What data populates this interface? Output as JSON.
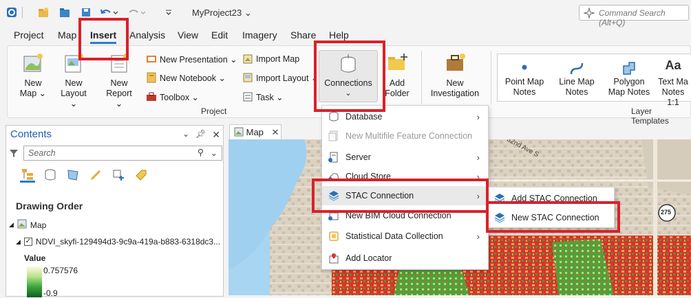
{
  "titlebar": {
    "project_title": "MyProject23 ⌄",
    "command_search": "Command Search (Alt+Q)"
  },
  "menu": {
    "tabs": [
      {
        "label": "Project"
      },
      {
        "label": "Map"
      },
      {
        "label": "Insert"
      },
      {
        "label": "Analysis"
      },
      {
        "label": "View"
      },
      {
        "label": "Edit"
      },
      {
        "label": "Imagery"
      },
      {
        "label": "Share"
      },
      {
        "label": "Help"
      }
    ]
  },
  "ribbon": {
    "new_map": "New Map ⌄",
    "new_layout": "New Layout ⌄",
    "new_report": "New Report ⌄",
    "new_presentation": "New Presentation ⌄",
    "new_notebook": "New Notebook ⌄",
    "toolbox": "Toolbox ⌄",
    "import_map": "Import Map",
    "import_layout": "Import Layout ⌄",
    "task": "Task ⌄",
    "connections": "Connections",
    "add_folder": "Add Folder",
    "new_investigation": "New Investigation",
    "group_project": "Project",
    "point_map_notes": "Point Map Notes",
    "line_map_notes": "Line Map Notes",
    "polygon_map_notes": "Polygon Map Notes",
    "text_map_notes": "Text Ma Notes 1:1",
    "group_layer_templates": "Layer Templates"
  },
  "contents": {
    "title": "Contents",
    "search_placeholder": "Search",
    "drawing_order": "Drawing Order",
    "map_item": "Map",
    "layer_name": "NDVI_skyfi-129494d3-9c9a-419a-b883-6318dc3...",
    "legend_title": "Value",
    "legend_max": "0.757576",
    "legend_min": "-0.9"
  },
  "map_tab": {
    "label": "Map"
  },
  "map_labels": {
    "street": "32nd Ave S",
    "route": "275"
  },
  "connections_menu": {
    "items": [
      {
        "label": "Database",
        "submenu": true,
        "enabled": true
      },
      {
        "label": "New Multifile Feature Connection",
        "submenu": false,
        "enabled": false
      },
      {
        "label": "Server",
        "submenu": true,
        "enabled": true
      },
      {
        "label": "Cloud Store",
        "submenu": true,
        "enabled": true
      },
      {
        "label": "STAC Connection",
        "submenu": true,
        "enabled": true
      },
      {
        "label": "New BIM Cloud Connection",
        "submenu": false,
        "enabled": true
      },
      {
        "label": "Statistical Data Collection",
        "submenu": true,
        "enabled": true
      },
      {
        "label": "Add Locator",
        "submenu": false,
        "enabled": true
      }
    ]
  },
  "stac_submenu": {
    "items": [
      {
        "label": "Add STAC Connection"
      },
      {
        "label": "New STAC Connection"
      }
    ]
  },
  "colors": {
    "accent": "#2a7bd3",
    "annotation": "#d9212b",
    "highlight": "#e9e9e9"
  }
}
